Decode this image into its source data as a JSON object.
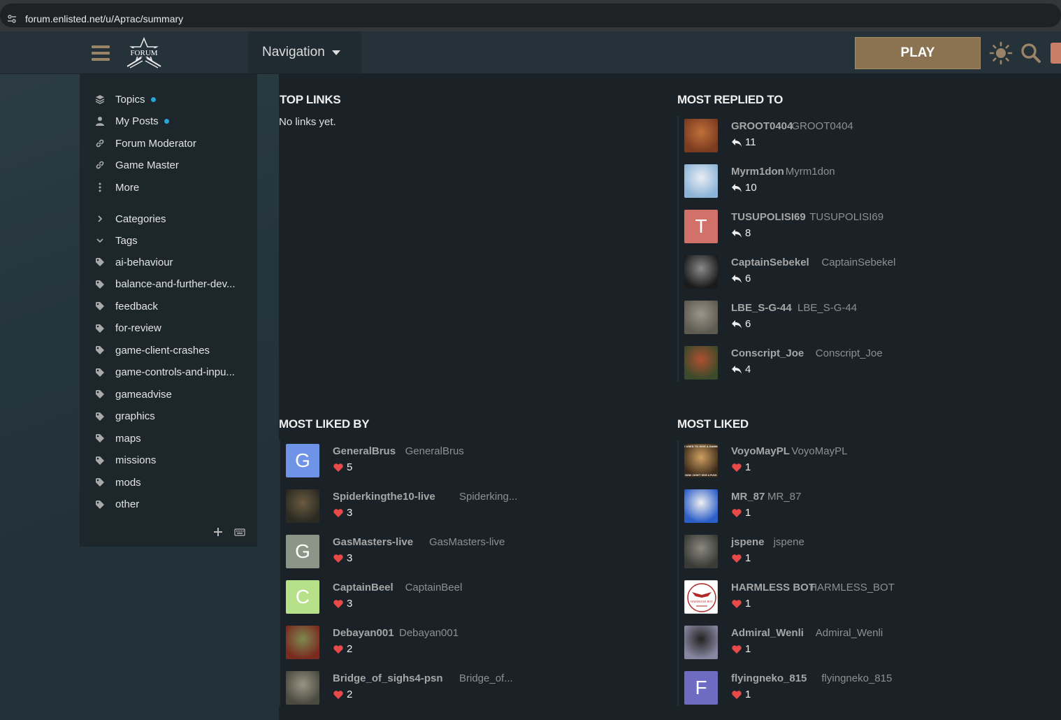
{
  "browser": {
    "url": "forum.enlisted.net/u/Артас/summary"
  },
  "header": {
    "logo_text": "FORUM",
    "nav_label": "Navigation",
    "play_label": "PLAY"
  },
  "sidebar": {
    "items": [
      {
        "label": "Topics",
        "icon": "layers-icon",
        "dot": true
      },
      {
        "label": "My Posts",
        "icon": "user-icon",
        "dot": true
      },
      {
        "label": "Forum Moderator",
        "icon": "link-icon"
      },
      {
        "label": "Game Master",
        "icon": "link-icon"
      },
      {
        "label": "More",
        "icon": "vertical-dots-icon"
      }
    ],
    "sections": [
      {
        "label": "Categories",
        "icon": "chevron-right-icon"
      },
      {
        "label": "Tags",
        "icon": "chevron-down-icon"
      }
    ],
    "tags": [
      "ai-behaviour",
      "balance-and-further-dev...",
      "feedback",
      "for-review",
      "game-client-crashes",
      "game-controls-and-inpu...",
      "gameadvise",
      "graphics",
      "maps",
      "missions",
      "mods",
      "other"
    ]
  },
  "sections": {
    "top_links": {
      "title": "TOP LINKS",
      "empty": "No links yet."
    },
    "most_replied_to": {
      "title": "MOST REPLIED TO",
      "users": [
        {
          "username": "GROOT0404",
          "name": "GROOT0404",
          "count": "11",
          "avatar": "photo",
          "colors": [
            "#7a3b20",
            "#c0703a"
          ]
        },
        {
          "username": "Myrm1don",
          "name": "Myrm1don",
          "count": "10",
          "avatar": "photo",
          "colors": [
            "#8db4d8",
            "#e9eef3"
          ]
        },
        {
          "username": "TUSUPOLISI69",
          "name": "TUSUPOLISI69",
          "count": "8",
          "avatar": "letter",
          "letter": "T",
          "color": "#d0716a"
        },
        {
          "username": "CaptainSebekel",
          "name": "CaptainSebekel",
          "count": "6",
          "avatar": "photo",
          "colors": [
            "#1b1b1b",
            "#8a8a8a"
          ]
        },
        {
          "username": "LBE_S-G-44",
          "name": "LBE_S-G-44",
          "count": "6",
          "avatar": "photo",
          "colors": [
            "#5d5a52",
            "#9c9688"
          ]
        },
        {
          "username": "Conscript_Joe",
          "name": "Conscript_Joe",
          "count": "4",
          "avatar": "photo",
          "colors": [
            "#3a4a2a",
            "#b05030"
          ]
        }
      ]
    },
    "most_liked_by": {
      "title": "MOST LIKED BY",
      "users": [
        {
          "username": "GeneralBrus",
          "name": "GeneralBrus",
          "count": "5",
          "avatar": "letter",
          "letter": "G",
          "color": "#6f93e6"
        },
        {
          "username": "Spiderkingthe10-live",
          "name": "Spiderking...",
          "count": "3",
          "avatar": "photo",
          "colors": [
            "#2a2a22",
            "#6a5a40"
          ]
        },
        {
          "username": "GasMasters-live",
          "name": "GasMasters-live",
          "count": "3",
          "avatar": "letter",
          "letter": "G",
          "color": "#8c9688"
        },
        {
          "username": "CaptainBeel",
          "name": "CaptainBeel",
          "count": "3",
          "avatar": "letter",
          "letter": "C",
          "color": "#b7e08a"
        },
        {
          "username": "Debayan001",
          "name": "Debayan001",
          "count": "2",
          "avatar": "photo",
          "colors": [
            "#7a2a20",
            "#7c8a50"
          ]
        },
        {
          "username": "Bridge_of_sighs4-psn",
          "name": "Bridge_of...",
          "count": "2",
          "avatar": "photo",
          "colors": [
            "#4a4a40",
            "#9a9484"
          ]
        }
      ]
    },
    "most_liked": {
      "title": "MOST LIKED",
      "users": [
        {
          "username": "VoyoMayPL",
          "name": "VoyoMayPL",
          "count": "1",
          "avatar": "photo",
          "colors": [
            "#3a2a1a",
            "#d0a060"
          ],
          "caption_top": "I USED TO GIVE A DAMN",
          "caption_bottom": "NOW I DON'T GIVE A FUCK"
        },
        {
          "username": "MR_87",
          "name": "MR_87",
          "count": "1",
          "avatar": "photo",
          "colors": [
            "#2c5ec8",
            "#f0f0f0"
          ]
        },
        {
          "username": "jspene",
          "name": "jspene",
          "count": "1",
          "avatar": "photo",
          "colors": [
            "#3a3a36",
            "#8a8a80"
          ]
        },
        {
          "username": "HARMLESS BOT",
          "name": "HARMLESS_BOT",
          "count": "1",
          "avatar": "badge",
          "badge_text": "HARMLESS BOT",
          "colors": [
            "#ffffff",
            "#b02a2a"
          ]
        },
        {
          "username": "Admiral_Wenli",
          "name": "Admiral_Wenli",
          "count": "1",
          "avatar": "photo",
          "colors": [
            "#8886a0",
            "#222222"
          ]
        },
        {
          "username": "flyingneko_815",
          "name": "flyingneko_815",
          "count": "1",
          "avatar": "letter",
          "letter": "F",
          "color": "#6d6bc2"
        }
      ]
    }
  },
  "colors": {
    "accent": "#8b7351",
    "dot": "#28a6d8",
    "heart": "#e84a4a"
  }
}
